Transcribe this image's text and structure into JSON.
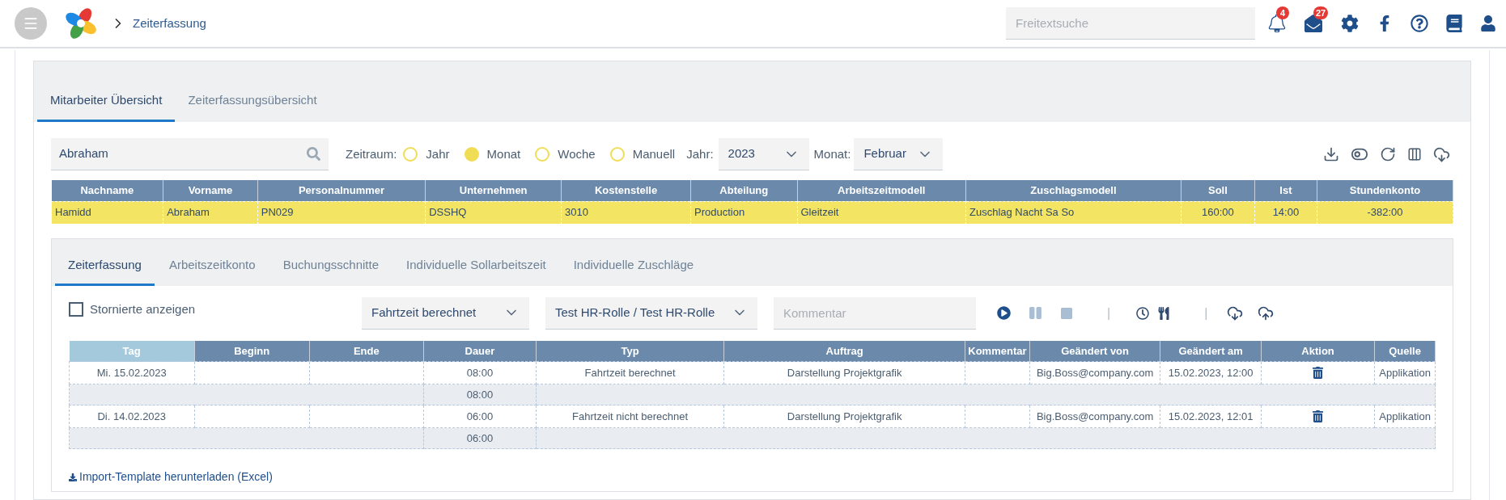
{
  "header": {
    "breadcrumb": "Zeiterfassung",
    "search": {
      "placeholder": "Freitextsuche"
    },
    "notifications": "4",
    "messages": "27"
  },
  "main_tabs": [
    {
      "label": "Mitarbeiter Übersicht",
      "selected": true
    },
    {
      "label": "Zeiterfassungsübersicht",
      "selected": false
    }
  ],
  "filter": {
    "search_value": "Abraham",
    "period_label": "Zeitraum:",
    "periods": [
      {
        "label": "Jahr",
        "selected": false
      },
      {
        "label": "Monat",
        "selected": true
      },
      {
        "label": "Woche",
        "selected": false
      },
      {
        "label": "Manuell",
        "selected": false
      }
    ],
    "year_label": "Jahr:",
    "year": "2023",
    "month_label": "Monat:",
    "month": "Februar"
  },
  "employees": {
    "columns": [
      "Nachname",
      "Vorname",
      "Personalnummer",
      "Unternehmen",
      "Kostenstelle",
      "Abteilung",
      "Arbeitszeitmodell",
      "Zuschlagsmodell",
      "Soll",
      "Ist",
      "Stundenkonto"
    ],
    "rows": [
      {
        "selected": true,
        "cells": [
          "Hamidd",
          "Abraham",
          "PN029",
          "DSSHQ",
          "3010",
          "Production",
          "Gleitzeit",
          "Zuschlag Nacht Sa So",
          "160:00",
          "14:00",
          "-382:00"
        ]
      }
    ]
  },
  "detail_tabs": [
    {
      "label": "Zeiterfassung",
      "selected": true
    },
    {
      "label": "Arbeitszeitkonto",
      "selected": false
    },
    {
      "label": "Buchungsschnitte",
      "selected": false
    },
    {
      "label": "Individuelle Sollarbeitszeit",
      "selected": false
    },
    {
      "label": "Individuelle Zuschläge",
      "selected": false
    }
  ],
  "toolbar": {
    "show_cancelled": {
      "label": "Stornierte anzeigen",
      "checked": false
    },
    "type": "Fahrtzeit berechnet",
    "role": "Test HR-Rolle / Test HR-Rolle",
    "comment": {
      "placeholder": "Kommentar"
    },
    "separators": [
      "|",
      "|"
    ]
  },
  "entries": {
    "columns": [
      {
        "label": "Tag",
        "sorted": true
      },
      {
        "label": "Beginn",
        "sorted": false
      },
      {
        "label": "Ende",
        "sorted": false
      },
      {
        "label": "Dauer",
        "sorted": false
      },
      {
        "label": "Typ",
        "sorted": false
      },
      {
        "label": "Auftrag",
        "sorted": false
      },
      {
        "label": "Kommentar",
        "sorted": false
      },
      {
        "label": "Geändert von",
        "sorted": false
      },
      {
        "label": "Geändert am",
        "sorted": false
      },
      {
        "label": "Aktion",
        "sorted": false
      },
      {
        "label": "Quelle",
        "sorted": false
      }
    ],
    "rows": [
      {
        "kind": "entry",
        "day": "Mi. 15.02.2023",
        "duration": "08:00",
        "type": "Fahrtzeit berechnet",
        "order": "Darstellung Projektgrafik",
        "changed_by": "Big.Boss@company.com",
        "changed_at": "15.02.2023, 12:00",
        "source": "Applikation"
      },
      {
        "kind": "sum",
        "duration": "08:00"
      },
      {
        "kind": "entry",
        "day": "Di. 14.02.2023",
        "duration": "06:00",
        "type": "Fahrtzeit nicht berechnet",
        "order": "Darstellung Projektgrafik",
        "changed_by": "Big.Boss@company.com",
        "changed_at": "15.02.2023, 12:01",
        "source": "Applikation"
      },
      {
        "kind": "sum",
        "duration": "06:00"
      }
    ]
  },
  "import_link": "Import-Template herunterladen (Excel)"
}
